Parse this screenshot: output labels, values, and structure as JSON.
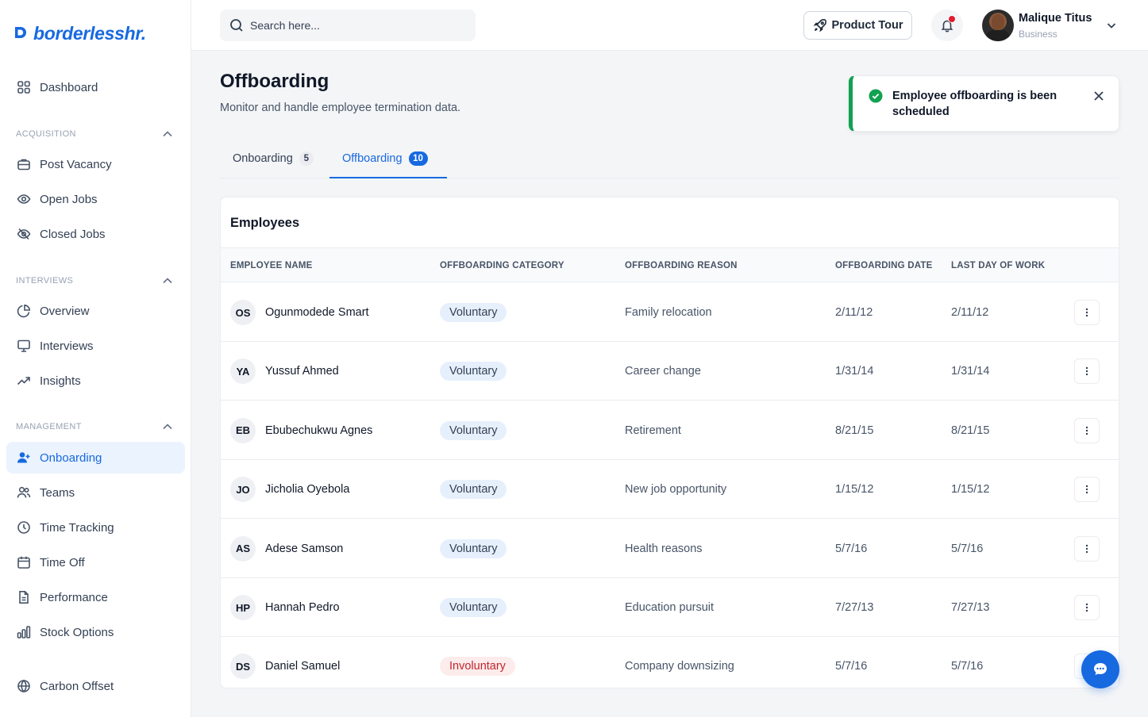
{
  "brand": {
    "name": "borderlesshr.",
    "color": "#1769e0"
  },
  "search": {
    "placeholder": "Search here..."
  },
  "topbar": {
    "product_tour_label": "Product Tour",
    "user_name": "Malique Titus",
    "user_role": "Business"
  },
  "sidebar": {
    "dashboard": "Dashboard",
    "sections": [
      {
        "title": "ACQUISITION",
        "items": [
          "Post Vacancy",
          "Open Jobs",
          "Closed Jobs"
        ]
      },
      {
        "title": "INTERVIEWS",
        "items": [
          "Overview",
          "Interviews",
          "Insights"
        ]
      },
      {
        "title": "MANAGEMENT",
        "items": [
          "Onboarding",
          "Teams",
          "Time Tracking",
          "Time Off",
          "Performance",
          "Stock Options"
        ]
      }
    ],
    "footer_item": "Carbon Offset",
    "active_item": "Onboarding"
  },
  "page": {
    "title": "Offboarding",
    "subtitle": "Monitor and handle employee termination data."
  },
  "toast": {
    "message": "Employee offboarding is been scheduled",
    "status_color": "#12a150"
  },
  "tabs": [
    {
      "label": "Onboarding",
      "count": "5"
    },
    {
      "label": "Offboarding",
      "count": "10"
    }
  ],
  "table": {
    "title": "Employees",
    "columns": [
      "EMPLOYEE NAME",
      "OFFBOARDING CATEGORY",
      "OFFBOARDING REASON",
      "OFFBOARDING DATE",
      "LAST DAY OF WORK"
    ],
    "rows": [
      {
        "initials": "OS",
        "name": "Ogunmodede Smart",
        "category": "Voluntary",
        "reason": "Family relocation",
        "date": "2/11/12",
        "last_day": "2/11/12"
      },
      {
        "initials": "YA",
        "name": "Yussuf Ahmed",
        "category": "Voluntary",
        "reason": "Career change",
        "date": "1/31/14",
        "last_day": "1/31/14"
      },
      {
        "initials": "EB",
        "name": "Ebubechukwu Agnes",
        "category": "Voluntary",
        "reason": "Retirement",
        "date": "8/21/15",
        "last_day": "8/21/15"
      },
      {
        "initials": "JO",
        "name": "Jicholia Oyebola",
        "category": "Voluntary",
        "reason": "New job opportunity",
        "date": "1/15/12",
        "last_day": "1/15/12"
      },
      {
        "initials": "AS",
        "name": "Adese Samson",
        "category": "Voluntary",
        "reason": "Health reasons",
        "date": "5/7/16",
        "last_day": "5/7/16"
      },
      {
        "initials": "HP",
        "name": "Hannah Pedro",
        "category": "Voluntary",
        "reason": "Education pursuit",
        "date": "7/27/13",
        "last_day": "7/27/13"
      },
      {
        "initials": "DS",
        "name": "Daniel Samuel",
        "category": "Involuntary",
        "reason": "Company downsizing",
        "date": "5/7/16",
        "last_day": "5/7/16"
      }
    ]
  }
}
